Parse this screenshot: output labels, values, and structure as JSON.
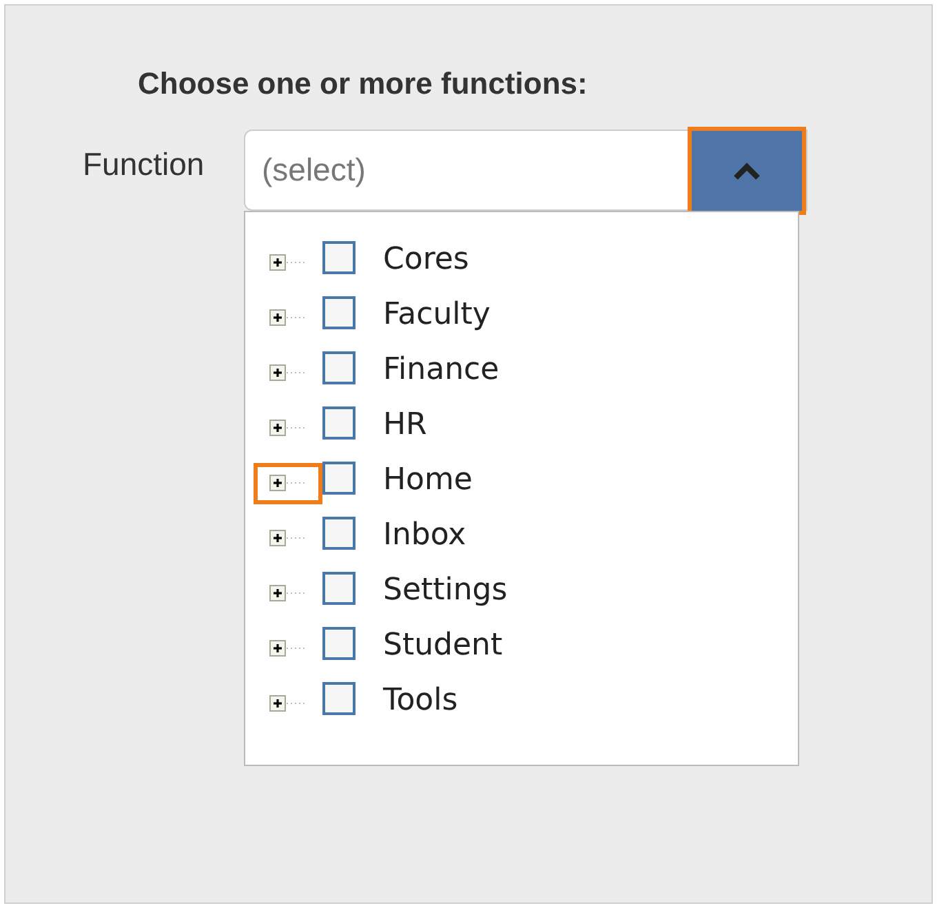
{
  "heading": "Choose one or more functions:",
  "field": {
    "label": "Function",
    "placeholder": "(select)",
    "toggle_highlighted": true,
    "expanded": true
  },
  "tree": [
    {
      "label": "Cores",
      "checked": false,
      "expanded": false,
      "highlighted": false
    },
    {
      "label": "Faculty",
      "checked": false,
      "expanded": false,
      "highlighted": false
    },
    {
      "label": "Finance",
      "checked": false,
      "expanded": false,
      "highlighted": false
    },
    {
      "label": "HR",
      "checked": false,
      "expanded": false,
      "highlighted": false
    },
    {
      "label": "Home",
      "checked": false,
      "expanded": false,
      "highlighted": true
    },
    {
      "label": "Inbox",
      "checked": false,
      "expanded": false,
      "highlighted": false
    },
    {
      "label": "Settings",
      "checked": false,
      "expanded": false,
      "highlighted": false
    },
    {
      "label": "Student",
      "checked": false,
      "expanded": false,
      "highlighted": false
    },
    {
      "label": "Tools",
      "checked": false,
      "expanded": false,
      "highlighted": false
    }
  ]
}
